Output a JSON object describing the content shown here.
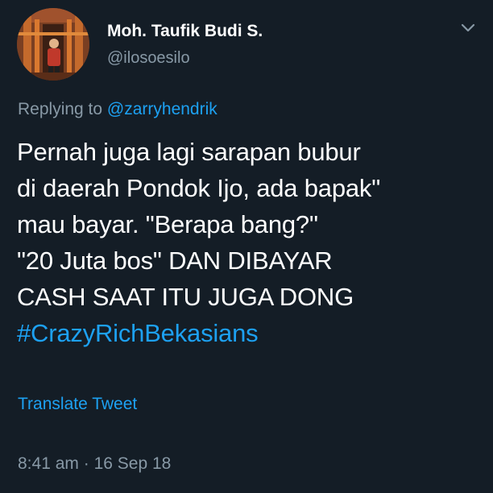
{
  "user": {
    "display_name": "Moh. Taufik Budi S.",
    "handle": "@ilosoesilo"
  },
  "reply": {
    "prefix": "Replying to",
    "mention": "@zarryhendrik"
  },
  "tweet": {
    "lines": [
      "Pernah juga lagi sarapan bubur",
      "di daerah Pondok Ijo, ada bapak\"",
      "mau bayar. \"Berapa bang?\"",
      "\"20 Juta bos\" DAN DIBAYAR",
      "CASH SAAT ITU JUGA DONG"
    ],
    "hashtag": "#CrazyRichBekasians"
  },
  "translate_label": "Translate Tweet",
  "meta": {
    "time": "8:41 am",
    "separator": "·",
    "date": "16 Sep 18"
  },
  "colors": {
    "background": "#141d26",
    "link": "#1da1f2",
    "secondary_text": "#8899a6",
    "primary_text": "#ffffff"
  },
  "icons": {
    "menu": "chevron-down-icon",
    "avatar": "profile-photo"
  }
}
